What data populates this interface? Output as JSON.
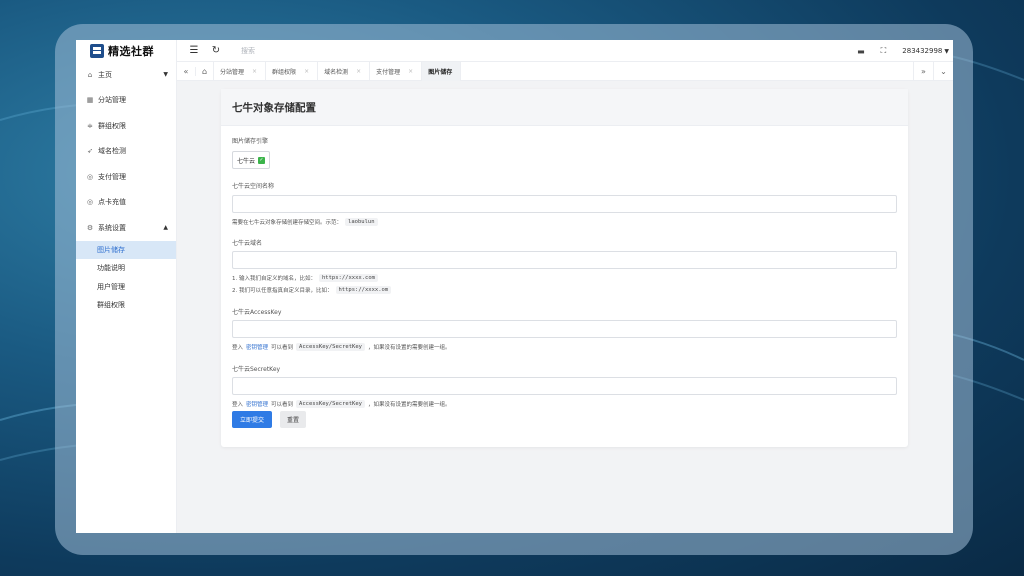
{
  "brand": {
    "name": "精选社群"
  },
  "topbar": {
    "search_placeholder": "搜索",
    "username": "283432998"
  },
  "sidebar": {
    "items": [
      {
        "label": "主页",
        "icon": "home-icon",
        "glyph": "⌂",
        "caret": "▼"
      },
      {
        "label": "分站管理",
        "icon": "grid-icon",
        "glyph": "▦"
      },
      {
        "label": "群组权限",
        "icon": "sliders-icon",
        "glyph": "≑"
      },
      {
        "label": "域名检测",
        "icon": "send-icon",
        "glyph": "➶"
      },
      {
        "label": "支付管理",
        "icon": "shield-icon",
        "glyph": "◎"
      },
      {
        "label": "点卡充值",
        "icon": "shield-check-icon",
        "glyph": "◎"
      },
      {
        "label": "系统设置",
        "icon": "gear-icon",
        "glyph": "⚙",
        "caret": "▲"
      }
    ],
    "subitems": [
      {
        "label": "图片储存",
        "active": true
      },
      {
        "label": "功能说明",
        "active": false
      },
      {
        "label": "用户管理",
        "active": false
      },
      {
        "label": "群组权限",
        "active": false
      }
    ]
  },
  "tabs": [
    {
      "label": "分站管理",
      "active": false
    },
    {
      "label": "群组权限",
      "active": false
    },
    {
      "label": "域名检测",
      "active": false
    },
    {
      "label": "支付管理",
      "active": false
    },
    {
      "label": "图片储存",
      "active": true
    }
  ],
  "card": {
    "title": "七牛对象存储配置",
    "engine_label": "图片储存引擎",
    "engine_value": "七牛云",
    "bucket_label": "七牛云空间名称",
    "bucket_help": "需要在七牛云对象存储创建存储空间。示范：",
    "bucket_help_code": "laobulun",
    "domain_label": "七牛云域名",
    "domain_help_1": "1. 输入我们自定义的域名，比如：",
    "domain_help_1_code": "https://xxxx.com",
    "domain_help_2": "2. 我们可以任意指真自定义目录，比如：",
    "domain_help_2_code": "https://xxxx.om",
    "ak_label": "七牛云AccessKey",
    "ak_help_pre": "登入",
    "ak_help_link": "密钥管理",
    "ak_help_mid": "可以看到",
    "ak_help_code": "AccessKey/SecretKey",
    "ak_help_post": "，如果没有设置的需要创建一组。",
    "sk_label": "七牛云SecretKey",
    "sk_help_pre": "登入",
    "sk_help_link": "密钥管理",
    "sk_help_mid": "可以看到",
    "sk_help_code": "AccessKey/SecretKey",
    "sk_help_post": "，如果没有设置的需要创建一组。",
    "submit_label": "立即提交",
    "reset_label": "重置"
  },
  "colors": {
    "primary": "#2f7be5",
    "active_menu_bg": "#d8e7f7",
    "success": "#3bb44a"
  }
}
